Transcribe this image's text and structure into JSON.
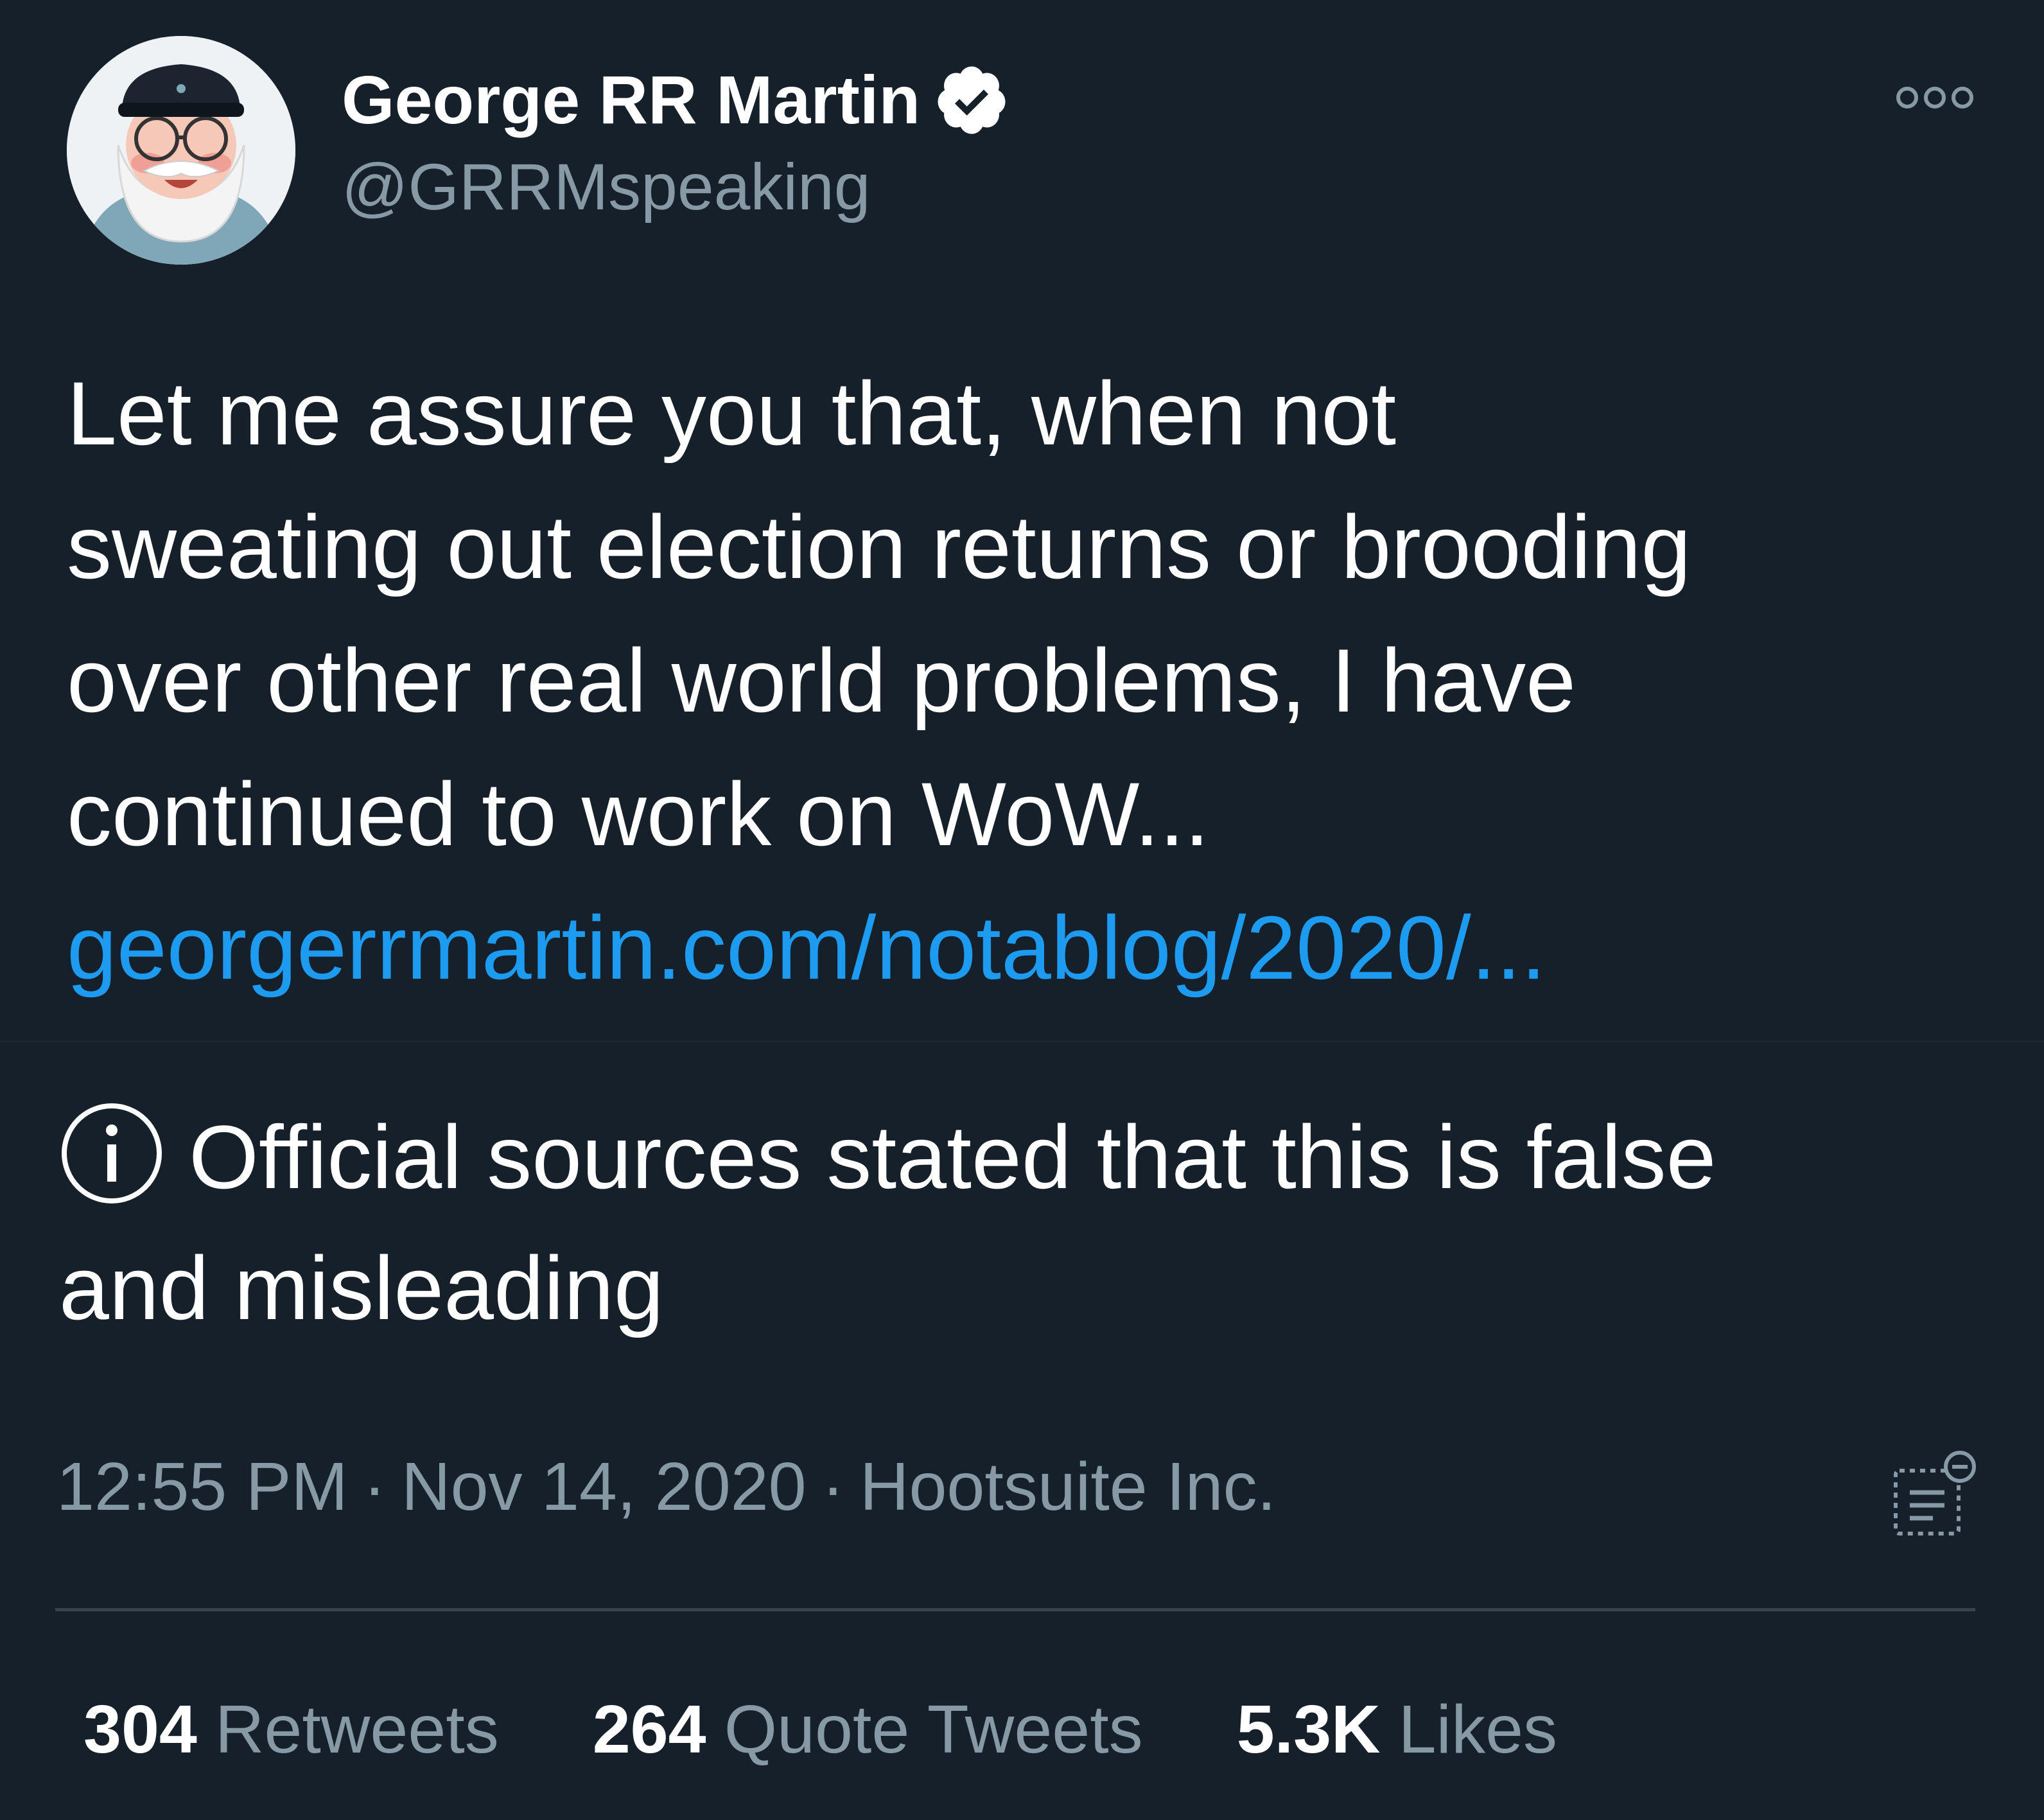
{
  "colors": {
    "background": "#15202b",
    "text_primary": "#ffffff",
    "text_secondary": "#8899a6",
    "link": "#1d9bf0",
    "divider": "#38444d"
  },
  "author": {
    "display_name": "George RR Martin",
    "handle": "@GRRMspeaking",
    "verified_icon": "verified-badge-icon",
    "avatar_icon": "avatar-cartoon"
  },
  "tweet": {
    "lines": [
      "Let me assure you that, when not",
      "sweating out election returns or brooding",
      "over other real world problems, I have",
      "continued to work on WoW..."
    ],
    "link_text": "georgerrmartin.com/notablog/2020/..."
  },
  "notice": {
    "icon": "info-icon",
    "line1": "Official sources stated that this is false",
    "line2": "and misleading"
  },
  "meta": {
    "time": "12:55 PM",
    "date": "Nov 14, 2020",
    "source": "Hootsuite Inc.",
    "separator": "·",
    "analytics_icon": "analytics-icon"
  },
  "stats": [
    {
      "count": "304",
      "label": "Retweets"
    },
    {
      "count": "264",
      "label": "Quote Tweets"
    },
    {
      "count": "5.3K",
      "label": "Likes"
    }
  ]
}
